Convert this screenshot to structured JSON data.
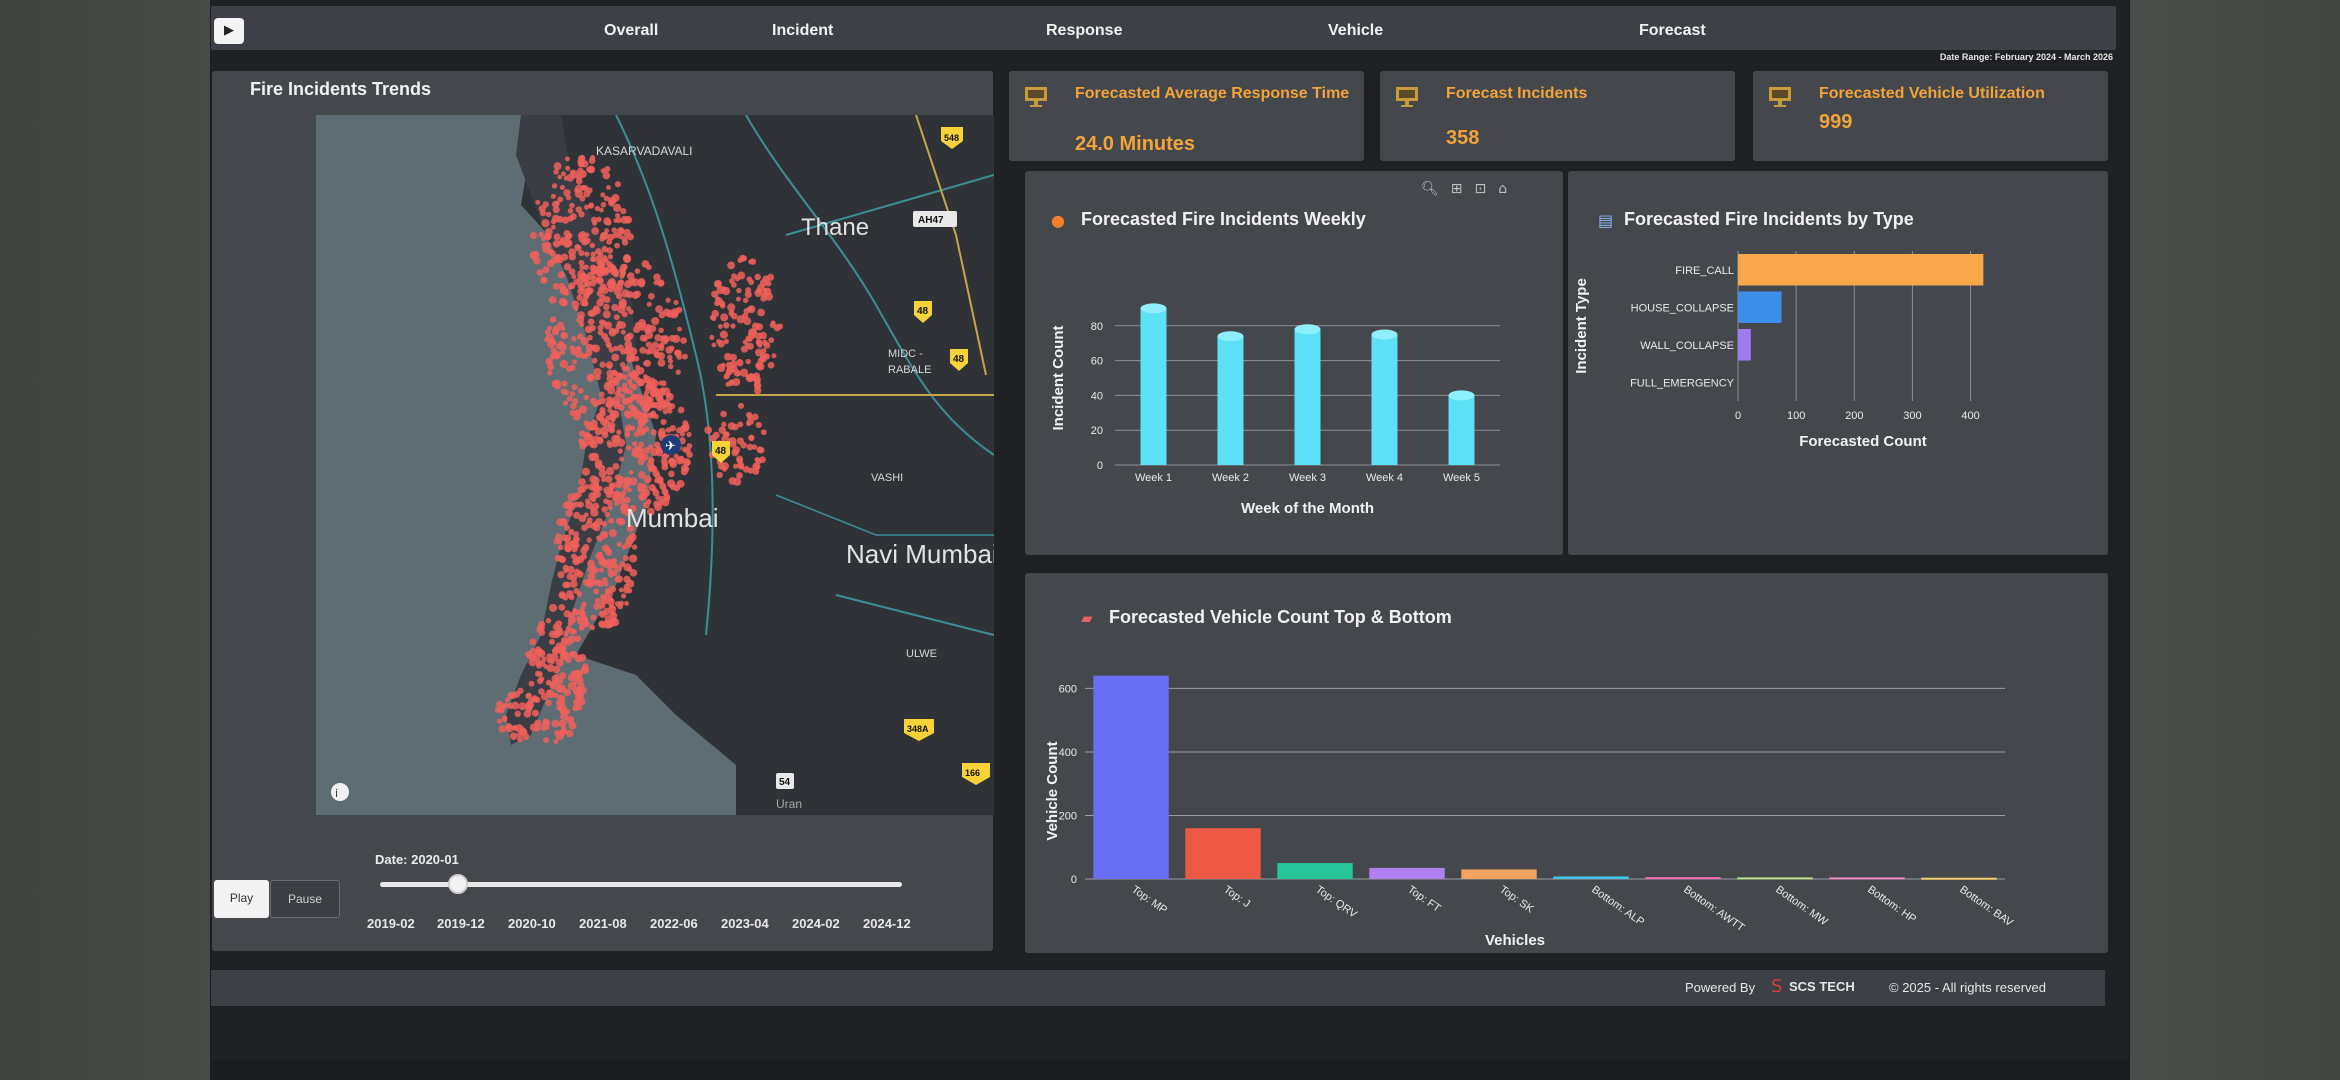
{
  "nav": {
    "items": [
      "Overall",
      "Incident",
      "Response",
      "Vehicle",
      "Forecast"
    ],
    "date_range": "Date Range: February 2024 - March 2026"
  },
  "map_panel": {
    "title": "Fire Incidents Trends",
    "labels": {
      "kasarvadavali": "KASARVADAVALI",
      "thane": "Thane",
      "mumbai": "Mumbai",
      "navi_mumbai": "Navi Mumbai",
      "midc": "MIDC -",
      "rabale": "RABALE",
      "vashi": "VASHI",
      "ulwe": "ULWE",
      "uran": "Uran",
      "ah47": "AH47",
      "r548": "548",
      "r48a": "48",
      "r48b": "48",
      "r48c": "48",
      "r348a": "348A",
      "r54": "54",
      "r166": "166"
    },
    "slider_label": "Date: 2020-01",
    "slider_value_fraction": 0.15,
    "ticks": [
      "2019-02",
      "2019-12",
      "2020-10",
      "2021-08",
      "2022-06",
      "2023-04",
      "2024-02",
      "2024-12"
    ],
    "play_label": "Play",
    "pause_label": "Pause"
  },
  "kpis": [
    {
      "label": "Forecasted Average Response Time",
      "value": "24.0 Minutes",
      "icon": "analytics-icon"
    },
    {
      "label": "Forecast Incidents",
      "value": "358",
      "icon": "analytics-icon"
    },
    {
      "label": "Forecasted Vehicle Utilization",
      "value": "999",
      "icon": "analytics-icon"
    }
  ],
  "weekly_chart": {
    "title": "Forecasted Fire Incidents Weekly",
    "chart_data": {
      "type": "bar",
      "categories": [
        "Week 1",
        "Week 2",
        "Week 3",
        "Week 4",
        "Week 5"
      ],
      "values": [
        90,
        74,
        78,
        75,
        40
      ],
      "xlabel": "Week of the Month",
      "ylabel": "Incident Count",
      "ylim": [
        0,
        100
      ],
      "yticks": [
        0,
        20,
        40,
        60,
        80
      ],
      "color": "#5ce1f7"
    }
  },
  "type_chart": {
    "title": "Forecasted Fire Incidents by Type",
    "chart_data": {
      "type": "bar",
      "orientation": "horizontal",
      "categories": [
        "FIRE_CALL",
        "HOUSE_COLLAPSE",
        "WALL_COLLAPSE",
        "FULL_EMERGENCY"
      ],
      "values": [
        422,
        75,
        22,
        0
      ],
      "colors": [
        "#f6a84b",
        "#3d8ee8",
        "#9c7cee",
        "#9c7cee"
      ],
      "xlabel": "Forecasted Count",
      "ylabel": "Incident Type",
      "xlim": [
        0,
        430
      ],
      "xticks": [
        0,
        100,
        200,
        300,
        400
      ]
    }
  },
  "vehicle_chart": {
    "title": "Forecasted Vehicle Count Top & Bottom",
    "chart_data": {
      "type": "bar",
      "categories": [
        "Top: MP",
        "Top: J",
        "Top: QRV",
        "Top: FT",
        "Top: SK",
        "Bottom: ALP",
        "Bottom: AWTT",
        "Bottom: MW",
        "Bottom: HP",
        "Bottom: BAV"
      ],
      "values": [
        640,
        160,
        50,
        35,
        30,
        8,
        6,
        5,
        5,
        4
      ],
      "colors": [
        "#6a6ef5",
        "#ec5a45",
        "#26c59a",
        "#b07ff0",
        "#f4a261",
        "#3fc5e8",
        "#f56cb6",
        "#b9e28c",
        "#f28cc5",
        "#f7d070"
      ],
      "xlabel": "Vehicles",
      "ylabel": "Vehicle Count",
      "ylim": [
        0,
        680
      ],
      "yticks": [
        0,
        200,
        400,
        600
      ]
    }
  },
  "footer": {
    "powered_by": "Powered By",
    "brand": "SCS TECH",
    "copyright": "© 2025 - All rights reserved"
  }
}
